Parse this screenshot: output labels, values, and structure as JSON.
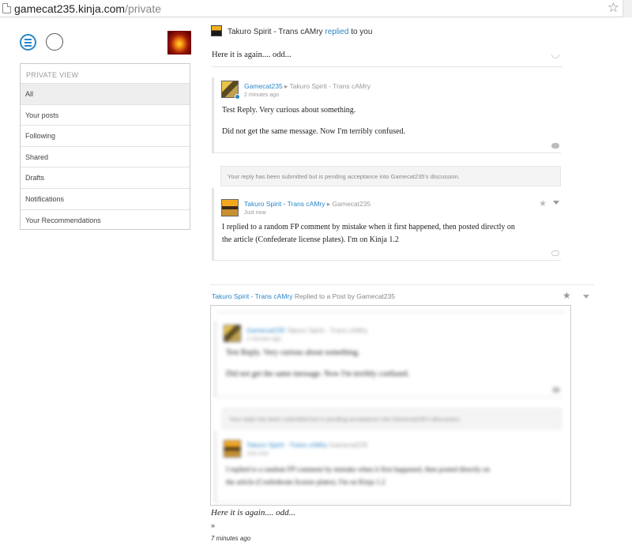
{
  "browser": {
    "url_host": "gamecat235.kinja.com",
    "url_path": "/private"
  },
  "sidebar": {
    "header": "PRIVATE VIEW",
    "items": [
      {
        "label": "All"
      },
      {
        "label": "Your posts"
      },
      {
        "label": "Following"
      },
      {
        "label": "Shared"
      },
      {
        "label": "Drafts"
      },
      {
        "label": "Notifications"
      },
      {
        "label": "Your Recommendations"
      }
    ]
  },
  "notification": {
    "author": "Takuro Spirit - Trans cAMry",
    "action": "replied",
    "suffix": "to you",
    "body": "Here it is again.... odd..."
  },
  "comments": [
    {
      "author": "Gamecat235",
      "target": "Takuro Spirit - Trans cAMry",
      "time": "2 minutes ago",
      "lines": [
        "Test Reply. Very curious about something.",
        "Did not get the same message. Now I'm terribly confused."
      ]
    },
    {
      "author": "Takuro Spirit - Trans cAMry",
      "target": "Gamecat235",
      "time": "Just now",
      "lines": [
        "I replied to a random FP comment by mistake when it first happened, then posted directly on",
        "the article (Confederate license plates). I'm on Kinja 1.2"
      ]
    }
  ],
  "pending_notice": "Your reply has been submitted but is pending acceptance into Gamecat235's discussion.",
  "post": {
    "author": "Takuro Spirit - Trans cAMry",
    "meta": "Replied to a Post by Gamecat235",
    "body": "Here it is again.... odd...",
    "more": "»",
    "time": "7 minutes ago"
  },
  "icons": {
    "menu": "hamburger-menu-icon",
    "profile": "profile-circle-icon",
    "star": "star-icon",
    "caret": "caret-down-icon",
    "reply": "speech-bubble-icon"
  },
  "colors": {
    "accent": "#2a86c8"
  }
}
